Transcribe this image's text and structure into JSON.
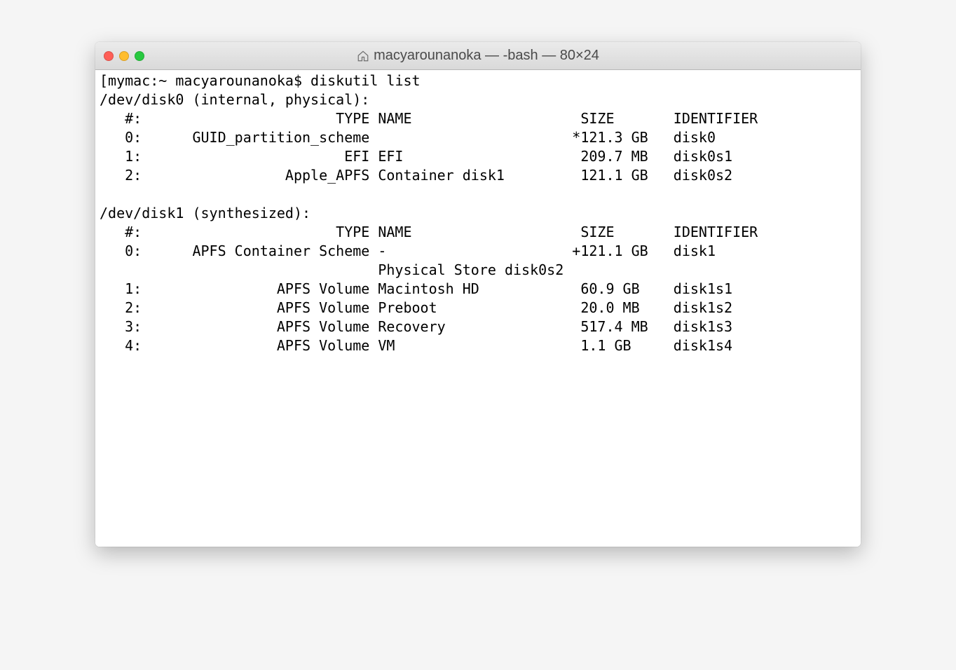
{
  "window": {
    "title": "macyarounanoka — -bash — 80×24"
  },
  "terminal": {
    "prompt": "[mymac:~ macyarounanoka$ ",
    "command": "diskutil list",
    "disk0": {
      "header": "/dev/disk0 (internal, physical):",
      "cols": "   #:                       TYPE NAME                    SIZE       IDENTIFIER",
      "r0": "   0:      GUID_partition_scheme                        *121.3 GB   disk0",
      "r1": "   1:                        EFI EFI                     209.7 MB   disk0s1",
      "r2": "   2:                 Apple_APFS Container disk1         121.1 GB   disk0s2"
    },
    "disk1": {
      "header": "/dev/disk1 (synthesized):",
      "cols": "   #:                       TYPE NAME                    SIZE       IDENTIFIER",
      "r0": "   0:      APFS Container Scheme -                      +121.1 GB   disk1",
      "phys": "                                 Physical Store disk0s2",
      "r1": "   1:                APFS Volume Macintosh HD            60.9 GB    disk1s1",
      "r2": "   2:                APFS Volume Preboot                 20.0 MB    disk1s2",
      "r3": "   3:                APFS Volume Recovery                517.4 MB   disk1s3",
      "r4": "   4:                APFS Volume VM                      1.1 GB     disk1s4"
    }
  }
}
